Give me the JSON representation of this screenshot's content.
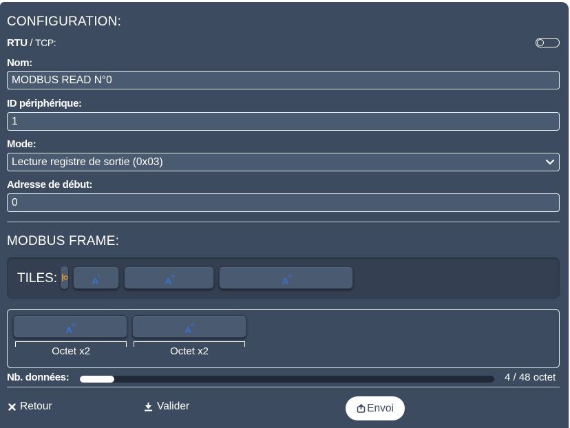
{
  "config": {
    "title": "CONFIGURATION:",
    "mode_switch": {
      "rtu": "RTU",
      "sep": " / ",
      "tcp": "TCP:"
    },
    "name": {
      "label": "Nom:",
      "value": "MODBUS READ N°0"
    },
    "device_id": {
      "label": "ID périphérique:",
      "value": "1"
    },
    "mode": {
      "label": "Mode:",
      "value": "Lecture registre de sortie (0x03)"
    },
    "start_address": {
      "label": "Adresse de début:",
      "value": "0"
    }
  },
  "frame": {
    "title": "MODBUS FRAME:",
    "tiles_label": "TILES:",
    "tiles": [
      {
        "icon": "text-format-icon",
        "superscript": "8"
      },
      {
        "icon": "text-format-icon",
        "superscript": "16"
      },
      {
        "icon": "text-format-icon",
        "superscript": "32"
      }
    ],
    "slots": [
      {
        "label": "Octet x2",
        "superscript": "16"
      },
      {
        "label": "Octet x2",
        "superscript": "16"
      }
    ]
  },
  "data_count": {
    "label": "Nb. données:",
    "value": "4 / 48 octet",
    "current": 4,
    "max": 48
  },
  "footer": {
    "back": "Retour",
    "validate": "Valider",
    "send": "Envoi"
  },
  "colors": {
    "panel": "#3d4b60",
    "accent_icon": "#2f7cf6",
    "handle": "#f29e2e"
  }
}
